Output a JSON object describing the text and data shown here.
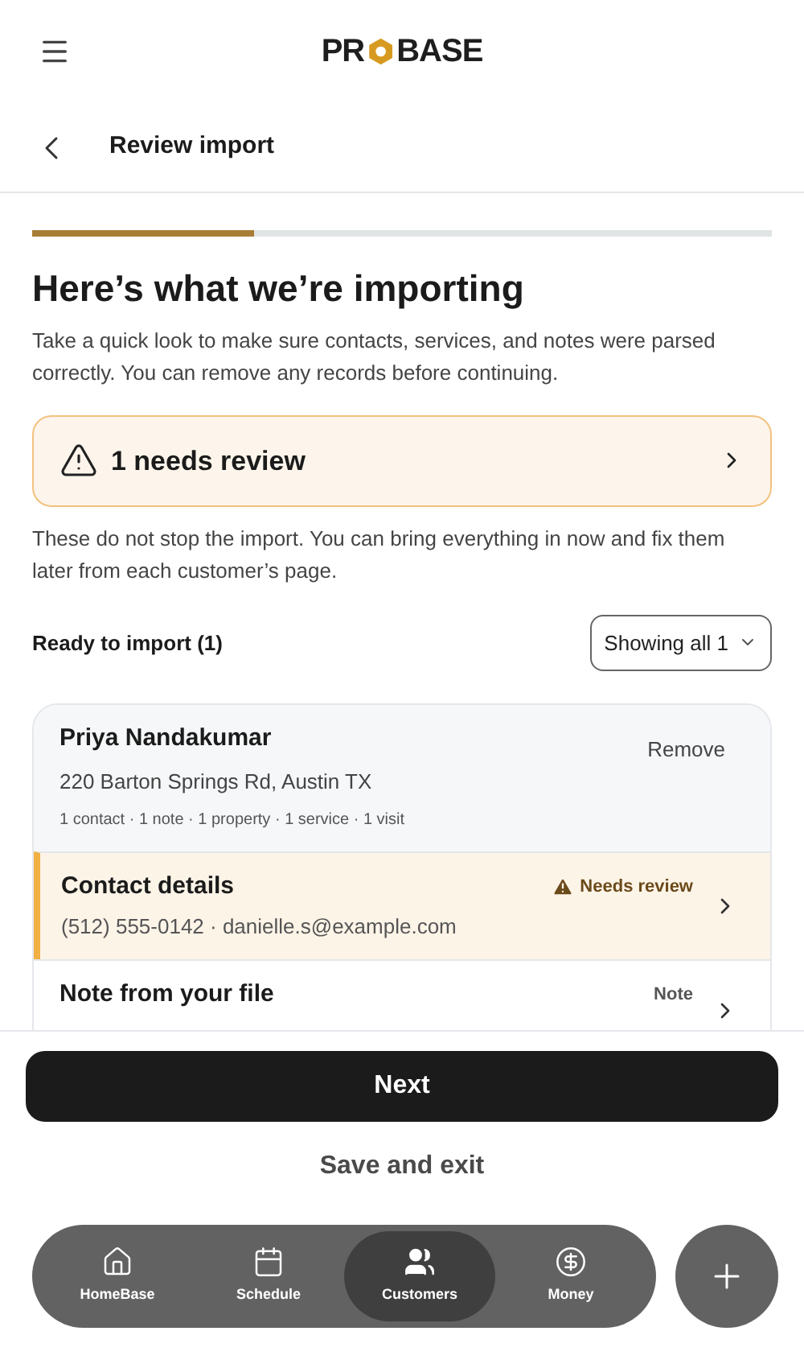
{
  "logo": {
    "before": "PR",
    "after": "BASE"
  },
  "header": {
    "title": "Review import"
  },
  "progress": {
    "level": 0.3
  },
  "intro": {
    "title": "Here’s what we’re importing",
    "text": "Take a quick look to make sure contacts, services, and notes were parsed correctly. You can remove any records before continuing."
  },
  "review_banner": {
    "label": "1 needs review"
  },
  "review_note": "These do not stop the import. You can bring everything in now and fix them later from each customer’s page.",
  "list_header": {
    "title": "Ready to import (1)",
    "filter": "Showing all 1"
  },
  "records": [
    {
      "name": "Priya Nandakumar",
      "address": "220 Barton Springs Rd, Austin TX",
      "summary": "1 contact · 1 note · 1 property · 1 service · 1 visit",
      "action": "Remove",
      "items": [
        {
          "title": "Contact details",
          "detail": "(512) 555-0142 · danielle.s@example.com",
          "kind": "warning",
          "tag": "Needs review"
        },
        {
          "title": "Note from your file",
          "kind": "plain",
          "tag": "Note"
        }
      ]
    }
  ],
  "actions": {
    "primary": "Next",
    "secondary": "Save and exit"
  },
  "nav": [
    {
      "label": "HomeBase",
      "selected": false
    },
    {
      "label": "Schedule",
      "selected": false
    },
    {
      "label": "Customers",
      "selected": true
    },
    {
      "label": "Money",
      "selected": false
    }
  ]
}
